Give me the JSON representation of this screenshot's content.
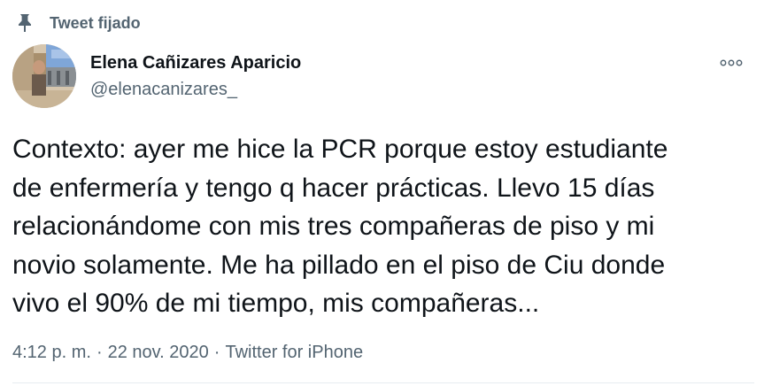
{
  "pinned": {
    "label": "Tweet fijado",
    "icon": "pin-icon"
  },
  "author": {
    "display_name": "Elena Cañizares Aparicio",
    "handle": "@elenacanizares_",
    "avatar_icon": "avatar-photo"
  },
  "tweet": {
    "text": "Contexto: ayer me hice la PCR porque estoy estudiante\nde enfermería y tengo q hacer prácticas. Llevo 15 días\nrelacionándome con mis tres compañeras de piso y mi\nnovio solamente. Me ha pillado en el piso de Ciu donde\nvivo el 90% de mi tiempo, mis compañeras...",
    "time": "4:12 p. m.",
    "separator": "·",
    "date": "22 nov. 2020",
    "source": "Twitter for iPhone"
  },
  "more_icon": "more-options-icon",
  "colors": {
    "primary_text": "#0f1419",
    "secondary_text": "#536471",
    "divider": "#e6ecf0"
  }
}
